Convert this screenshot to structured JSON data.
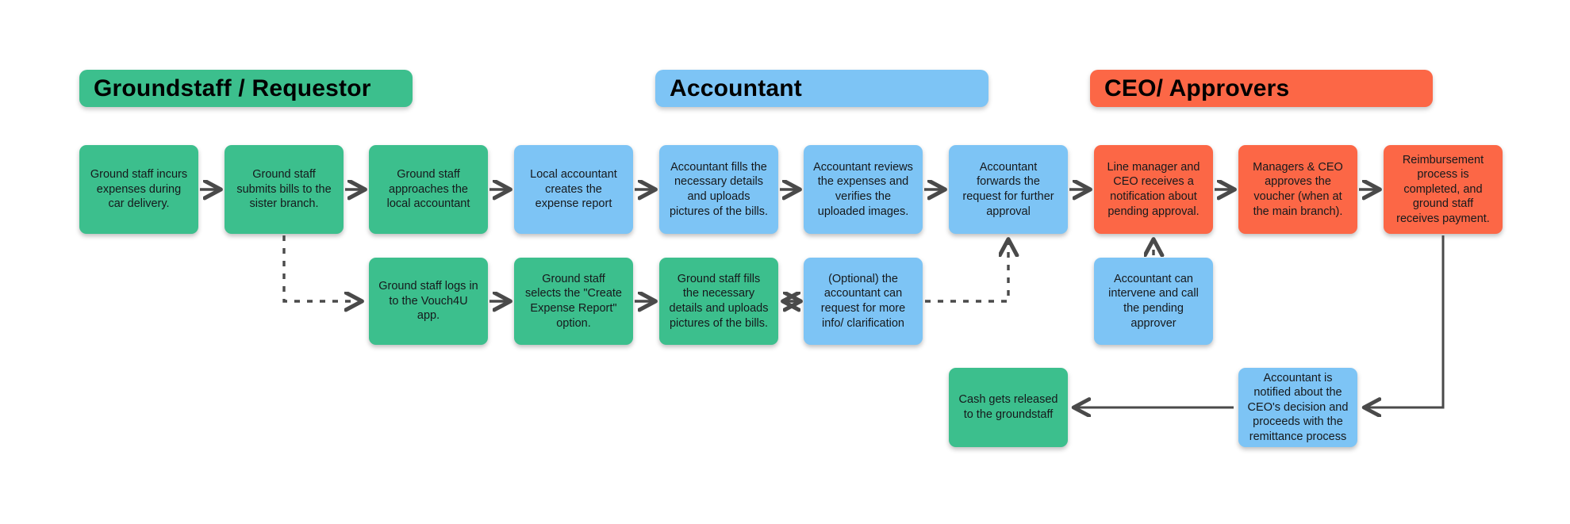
{
  "palette": {
    "green": "#3CBF8D",
    "blue": "#7DC4F5",
    "orange": "#FC6746",
    "arrow": "#4A4A4A",
    "text": "#16191C",
    "background": "#FFFFFF"
  },
  "lanes": [
    {
      "id": "groundstaff",
      "title": "Groundstaff / Requestor",
      "color": "#3CBF8D"
    },
    {
      "id": "accountant",
      "title": "Accountant",
      "color": "#7DC4F5"
    },
    {
      "id": "ceo",
      "title": "CEO/ Approvers",
      "color": "#FC6746"
    }
  ],
  "nodes": {
    "r1c1": {
      "text": "Ground staff incurs\nexpenses during\ncar delivery.",
      "color": "#3CBF8D",
      "lane": "groundstaff"
    },
    "r1c2": {
      "text": "Ground staff\nsubmits bills to the\nsister branch.",
      "color": "#3CBF8D",
      "lane": "groundstaff"
    },
    "r1c3": {
      "text": "Ground staff\napproaches the\nlocal accountant",
      "color": "#3CBF8D",
      "lane": "groundstaff"
    },
    "r1c4": {
      "text": "Local accountant\ncreates the\nexpense report",
      "color": "#7DC4F5",
      "lane": "accountant"
    },
    "r1c5": {
      "text": "Accountant fills the\nnecessary details\nand uploads\npictures of the bills.",
      "color": "#7DC4F5",
      "lane": "accountant"
    },
    "r1c6": {
      "text": "Accountant reviews\nthe expenses and\nverifies the\nuploaded images.",
      "color": "#7DC4F5",
      "lane": "accountant"
    },
    "r1c7": {
      "text": "Accountant\nforwards the\nrequest for further\napproval",
      "color": "#7DC4F5",
      "lane": "accountant"
    },
    "r1c8": {
      "text": "Line manager and\nCEO receives a\nnotification about\npending approval.",
      "color": "#FC6746",
      "lane": "ceo"
    },
    "r1c9": {
      "text": "Managers & CEO\napproves the\nvoucher (when at\nthe main branch).",
      "color": "#FC6746",
      "lane": "ceo"
    },
    "r1c10": {
      "text": "Reimbursement\nprocess is\ncompleted, and\nground staff\nreceives payment.",
      "color": "#FC6746",
      "lane": "ceo"
    },
    "r2c1": {
      "text": "Ground staff logs in\nto the Vouch4U\napp.",
      "color": "#3CBF8D",
      "lane": "groundstaff"
    },
    "r2c2": {
      "text": "Ground staff\nselects the \"Create\nExpense Report\"\noption.",
      "color": "#3CBF8D",
      "lane": "groundstaff"
    },
    "r2c3": {
      "text": "Ground staff fills\nthe necessary\ndetails and uploads\npictures of the bills.",
      "color": "#3CBF8D",
      "lane": "groundstaff"
    },
    "r2c4": {
      "text": "(Optional) the\naccountant can\nrequest for more\ninfo/ clarification",
      "color": "#7DC4F5",
      "lane": "accountant"
    },
    "r2c5": {
      "text": "Accountant can\nintervene and call\nthe pending\napprover",
      "color": "#7DC4F5",
      "lane": "accountant"
    },
    "r3c1": {
      "text": "Cash gets released\nto the groundstaff",
      "color": "#3CBF8D",
      "lane": "groundstaff"
    },
    "r3c2": {
      "text": "Accountant is\nnotified about the\nCEO's decision and\nproceeds with the\nremittance process",
      "color": "#7DC4F5",
      "lane": "accountant"
    }
  },
  "connectors": [
    {
      "id": "r1c1-r1c2",
      "style": "solid",
      "direction": "right"
    },
    {
      "id": "r1c2-r1c3",
      "style": "solid",
      "direction": "right"
    },
    {
      "id": "r1c3-r1c4",
      "style": "solid",
      "direction": "right"
    },
    {
      "id": "r1c4-r1c5",
      "style": "solid",
      "direction": "right"
    },
    {
      "id": "r1c5-r1c6",
      "style": "solid",
      "direction": "right"
    },
    {
      "id": "r1c6-r1c7",
      "style": "solid",
      "direction": "right"
    },
    {
      "id": "r1c7-r1c8",
      "style": "solid",
      "direction": "right"
    },
    {
      "id": "r1c8-r1c9",
      "style": "solid",
      "direction": "right"
    },
    {
      "id": "r1c9-r1c10",
      "style": "solid",
      "direction": "right"
    },
    {
      "id": "r1c2-r2c1",
      "style": "dashed",
      "direction": "down-right"
    },
    {
      "id": "r2c1-r2c2",
      "style": "solid",
      "direction": "right"
    },
    {
      "id": "r2c2-r2c3",
      "style": "solid",
      "direction": "right"
    },
    {
      "id": "r2c3-r2c4",
      "style": "solid",
      "direction": "both"
    },
    {
      "id": "r2c4-r1c7",
      "style": "dashed",
      "direction": "right-up"
    },
    {
      "id": "r2c5-r1c8",
      "style": "dashed",
      "direction": "up"
    },
    {
      "id": "r1c10-r3c2",
      "style": "solid",
      "direction": "down-left"
    },
    {
      "id": "r3c2-r3c1",
      "style": "solid",
      "direction": "left"
    }
  ]
}
